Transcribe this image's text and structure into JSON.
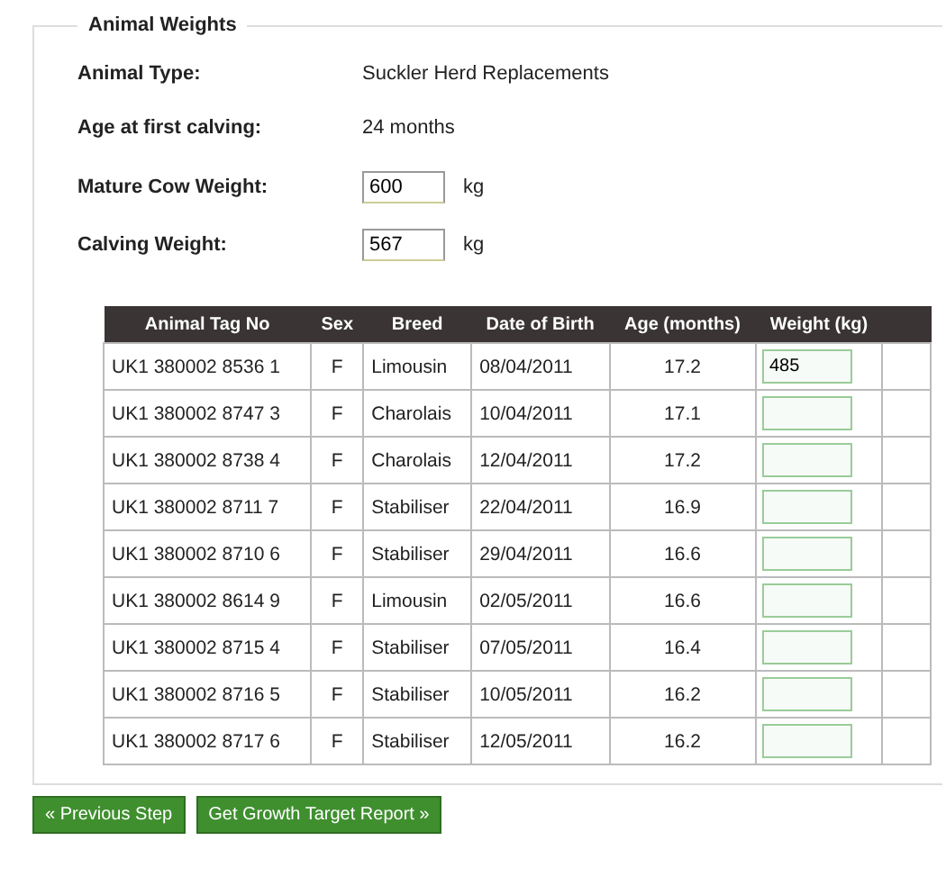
{
  "fieldset": {
    "legend": "Animal Weights"
  },
  "details": [
    {
      "kind": "text",
      "label": "Animal Type:",
      "value": "Suckler Herd Replacements"
    },
    {
      "kind": "text",
      "label": "Age at first calving:",
      "value": "24 months"
    },
    {
      "kind": "input",
      "label": "Mature Cow Weight:",
      "value": "600",
      "unit": "kg"
    },
    {
      "kind": "input",
      "label": "Calving Weight:",
      "value": "567",
      "unit": "kg"
    }
  ],
  "table": {
    "columns": [
      "Animal Tag No",
      "Sex",
      "Breed",
      "Date of Birth",
      "Age (months)",
      "Weight (kg)"
    ],
    "rows": [
      {
        "tag": "UK1 380002 8536 1",
        "sex": "F",
        "breed": "Limousin",
        "dob": "08/04/2011",
        "age": "17.2",
        "weight": "485"
      },
      {
        "tag": "UK1 380002 8747 3",
        "sex": "F",
        "breed": "Charolais",
        "dob": "10/04/2011",
        "age": "17.1"
      },
      {
        "tag": "UK1 380002 8738 4",
        "sex": "F",
        "breed": "Charolais",
        "dob": "12/04/2011",
        "age": "17.2"
      },
      {
        "tag": "UK1 380002 8711 7",
        "sex": "F",
        "breed": "Stabiliser",
        "dob": "22/04/2011",
        "age": "16.9"
      },
      {
        "tag": "UK1 380002 8710 6",
        "sex": "F",
        "breed": "Stabiliser",
        "dob": "29/04/2011",
        "age": "16.6"
      },
      {
        "tag": "UK1 380002 8614 9",
        "sex": "F",
        "breed": "Limousin",
        "dob": "02/05/2011",
        "age": "16.6"
      },
      {
        "tag": "UK1 380002 8715 4",
        "sex": "F",
        "breed": "Stabiliser",
        "dob": "07/05/2011",
        "age": "16.4"
      },
      {
        "tag": "UK1 380002 8716 5",
        "sex": "F",
        "breed": "Stabiliser",
        "dob": "10/05/2011",
        "age": "16.2"
      },
      {
        "tag": "UK1 380002 8717 6",
        "sex": "F",
        "breed": "Stabiliser",
        "dob": "12/05/2011",
        "age": "16.2"
      }
    ]
  },
  "buttons": [
    "« Previous Step",
    "Get Growth Target Report »"
  ]
}
